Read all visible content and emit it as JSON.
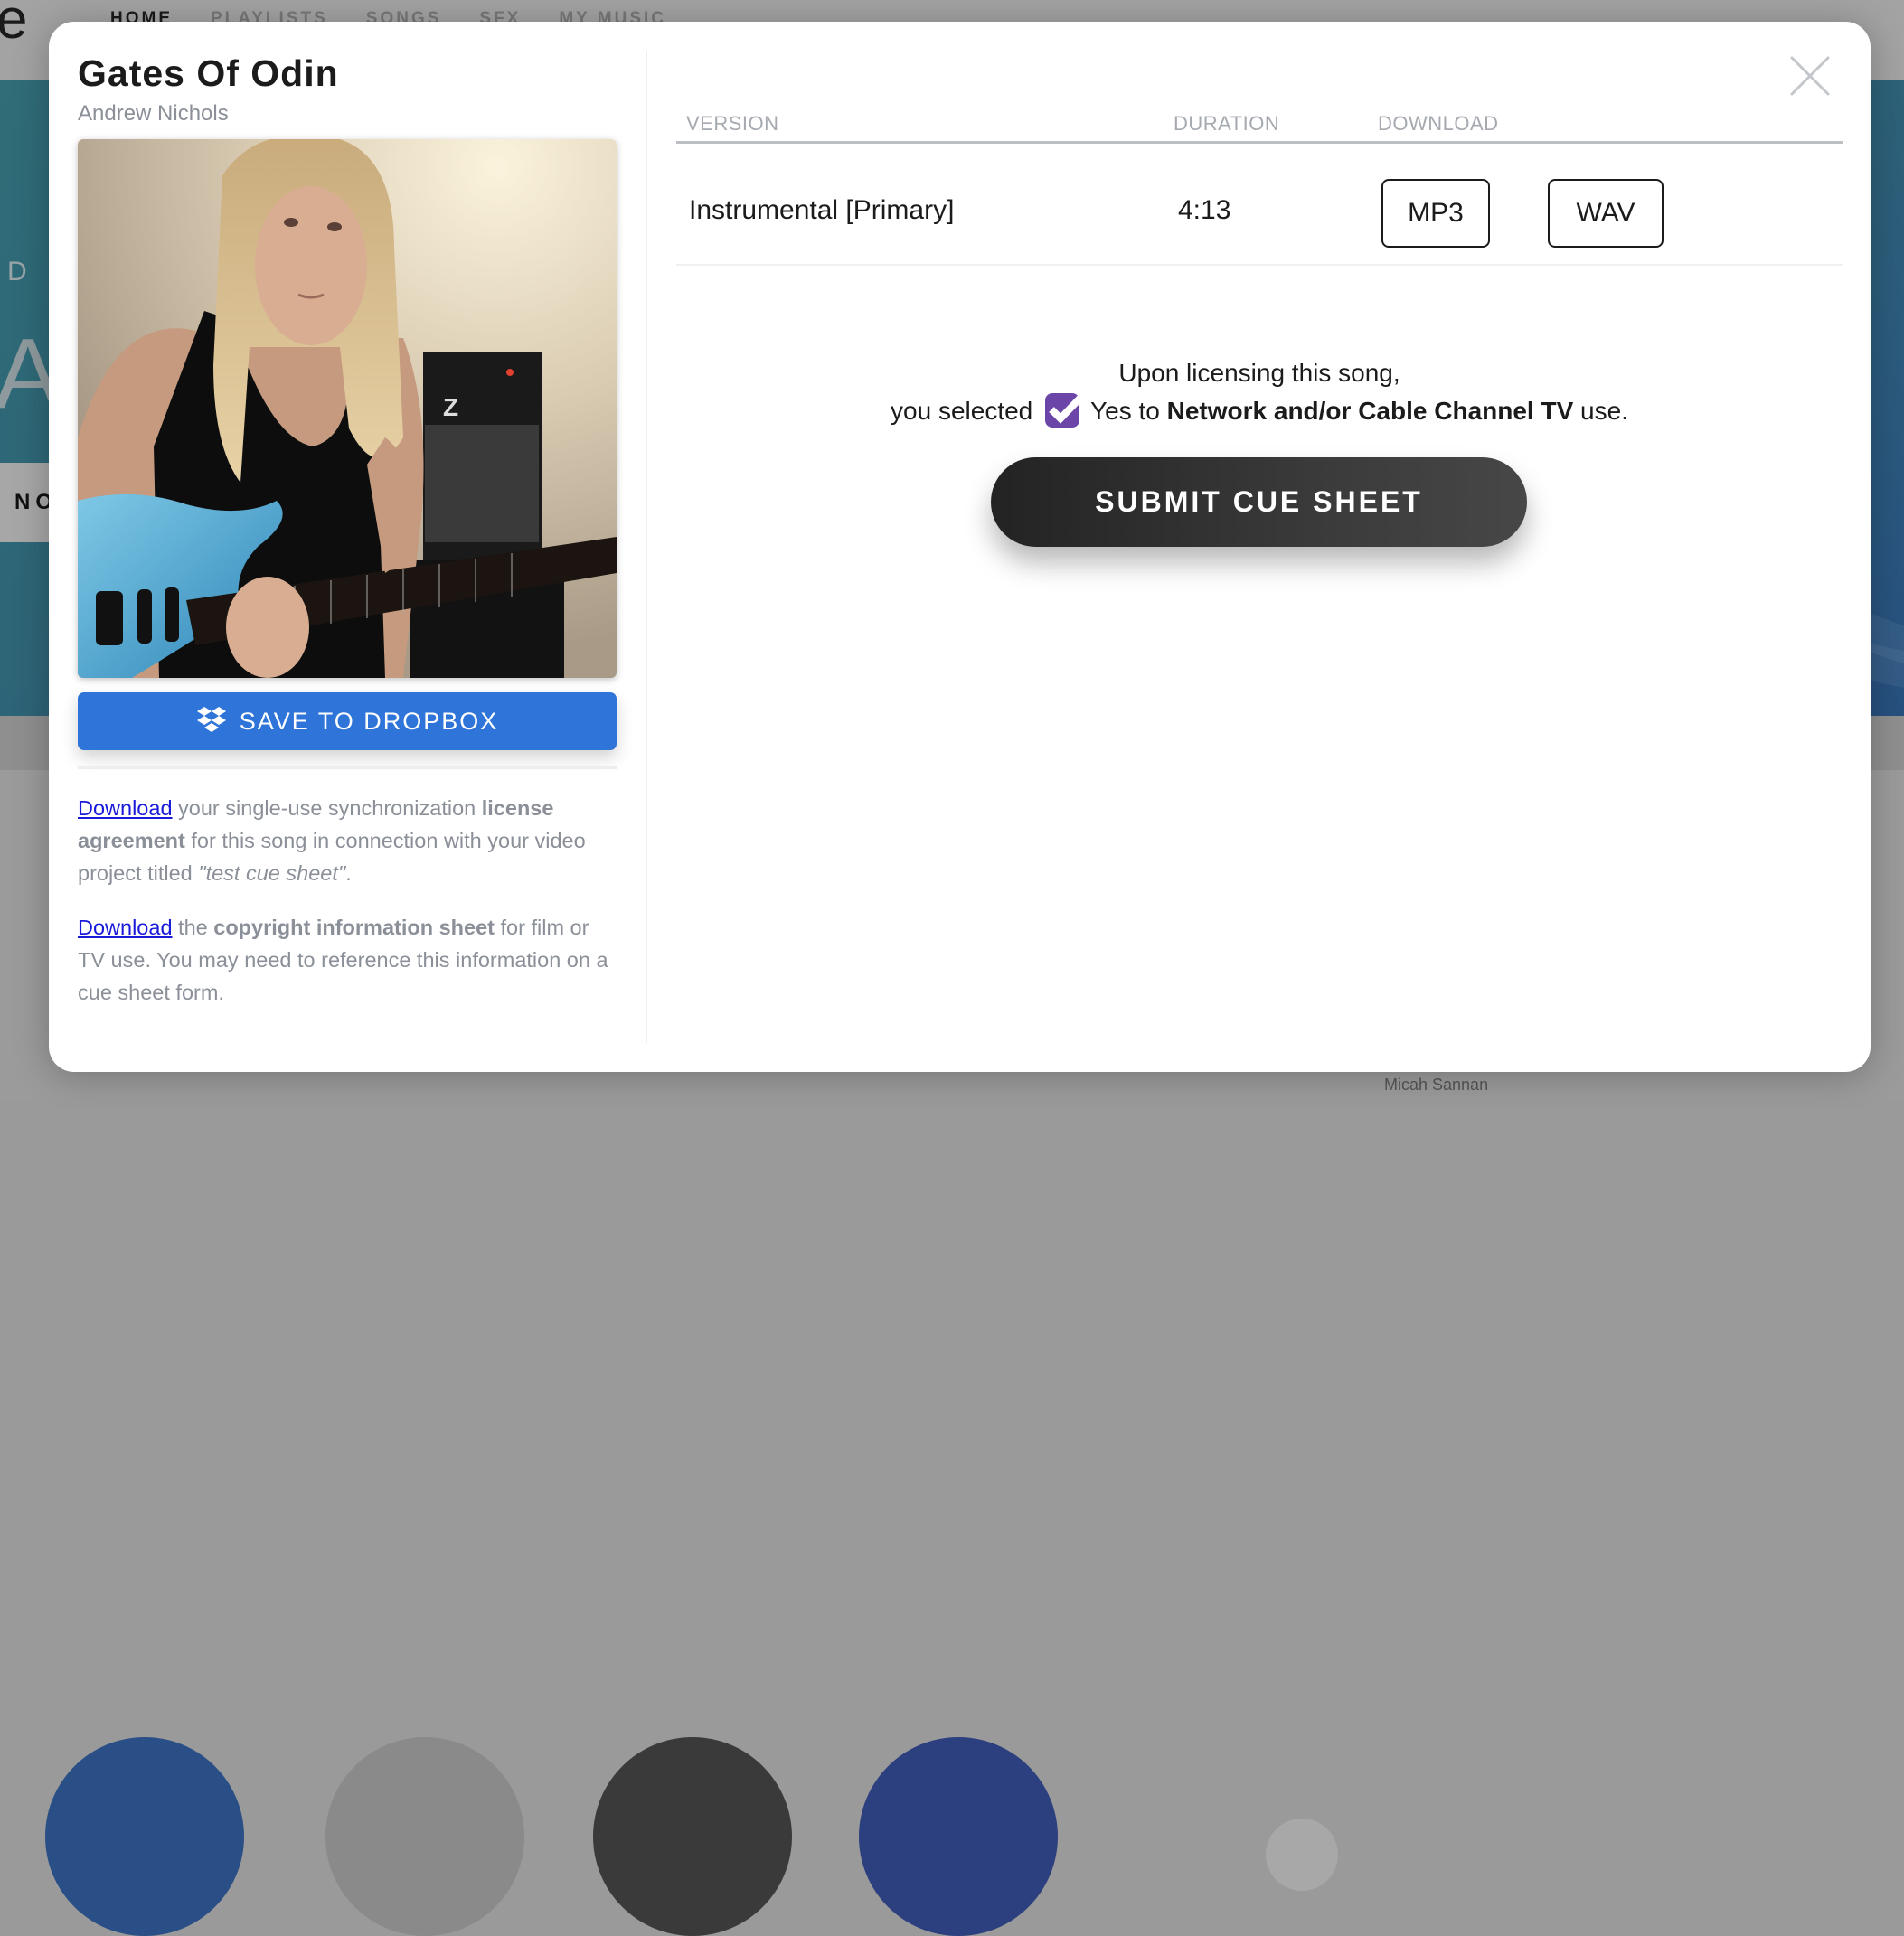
{
  "background": {
    "logo_letter": "e",
    "nav": [
      "HOME",
      "PLAYLISTS",
      "SONGS",
      "SFX",
      "MY MUSIC"
    ],
    "nav_active": "HOME",
    "hero_small_text": "D A",
    "hero_big_text": "A",
    "hero_button_text": "NO",
    "artist_name": "Micah Sannan"
  },
  "modal": {
    "song_title": "Gates Of Odin",
    "artist": "Andrew Nichols",
    "cover_alt": "Artist photo: long-haired guitarist with blue electric guitar in front of amplifier",
    "dropbox_button": "SAVE TO DROPBOX",
    "license_paragraph": {
      "link": "Download",
      "text1": " your single-use synchronization ",
      "bold1": "license agreement",
      "text2": " for this song in connection with your video project titled ",
      "italic": "\"test cue sheet\"",
      "text3": "."
    },
    "copyright_paragraph": {
      "link": "Download",
      "text1": " the ",
      "bold1": "copyright information sheet",
      "text2": " for film or TV use. You may need to reference this information on a cue sheet form."
    },
    "table": {
      "headers": {
        "version": "VERSION",
        "duration": "DURATION",
        "download": "DOWNLOAD"
      },
      "rows": [
        {
          "version": "Instrumental [Primary]",
          "duration": "4:13",
          "formats": [
            "MP3",
            "WAV"
          ]
        }
      ]
    },
    "notice": {
      "line1": "Upon licensing this song,",
      "prefix": "you selected",
      "yes_text": "Yes to ",
      "bold": "Network and/or Cable Channel TV",
      "suffix": " use.",
      "check_icon": "checkmark-badge-icon"
    },
    "submit_button": "SUBMIT CUE SHEET",
    "close_icon": "close-icon"
  },
  "colors": {
    "dropbox_blue": "#2f74d9",
    "link_blue": "#1a1adb",
    "check_purple": "#6b45a8",
    "submit_dark": "#2e2e2e",
    "muted_text": "#8a8f98"
  }
}
